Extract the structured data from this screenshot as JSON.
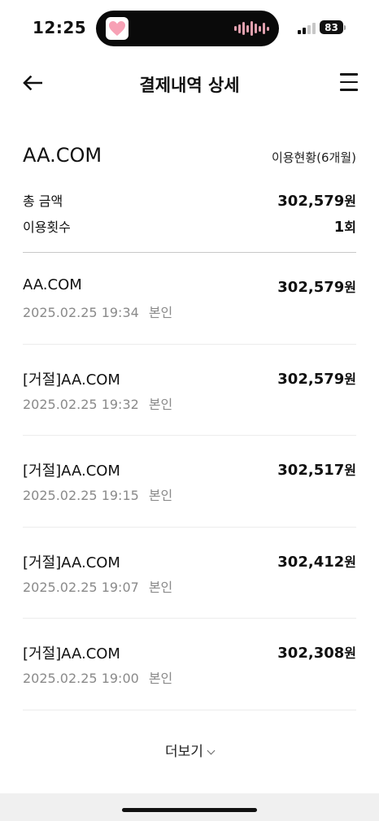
{
  "status_bar": {
    "time": "12:25",
    "battery": "83",
    "icons": [
      "heart-icon",
      "audio-wave-icon",
      "signal-icon",
      "battery-icon"
    ]
  },
  "header": {
    "title": "결제내역 상세",
    "back_icon": "arrow-left-icon",
    "menu_icon": "hamburger-menu-icon"
  },
  "merchant": {
    "name": "AA.COM",
    "usage_link": "이용현황(6개월)"
  },
  "summary": {
    "total_label": "총 금액",
    "total_value": "302,579",
    "total_unit": "원",
    "count_label": "이용횟수",
    "count_value": "1",
    "count_unit": "회"
  },
  "transactions": [
    {
      "name": "AA.COM",
      "amount": "302,579",
      "unit": "원",
      "datetime": "2025.02.25 19:34",
      "owner": "본인"
    },
    {
      "name": "[거절]AA.COM",
      "amount": "302,579",
      "unit": "원",
      "datetime": "2025.02.25 19:32",
      "owner": "본인"
    },
    {
      "name": "[거절]AA.COM",
      "amount": "302,517",
      "unit": "원",
      "datetime": "2025.02.25 19:15",
      "owner": "본인"
    },
    {
      "name": "[거절]AA.COM",
      "amount": "302,412",
      "unit": "원",
      "datetime": "2025.02.25 19:07",
      "owner": "본인"
    },
    {
      "name": "[거절]AA.COM",
      "amount": "302,308",
      "unit": "원",
      "datetime": "2025.02.25 19:00",
      "owner": "본인"
    }
  ],
  "more": {
    "label": "더보기",
    "icon": "chevron-down-icon"
  },
  "colors": {
    "text": "#111111",
    "muted": "#8a8a8a",
    "divider": "#c8c8c8",
    "row_divider": "#ececec",
    "island": "#0a0a0a",
    "heart": "#f7a1b5"
  }
}
